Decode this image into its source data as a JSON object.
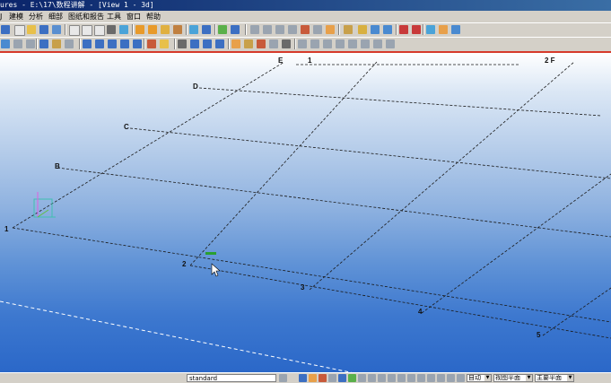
{
  "window": {
    "title": "ures - E:\\17\\数程讲解 - [View 1 - 3d]"
  },
  "menu": {
    "items": [
      {
        "label": "J"
      },
      {
        "label": "建模"
      },
      {
        "label": "分析"
      },
      {
        "label": "细部"
      },
      {
        "label": "图纸和报告"
      },
      {
        "label": "工具"
      },
      {
        "label": "窗口"
      },
      {
        "label": "帮助"
      }
    ]
  },
  "viewport": {
    "grid_labels_top": [
      "E",
      "1",
      "2 F"
    ],
    "grid_labels_left": [
      "D",
      "C",
      "B"
    ],
    "grid_labels_bottom": [
      "1",
      "2",
      "3",
      "4",
      "5"
    ]
  },
  "statusbar": {
    "view_filter_value": "standard",
    "combo1_value": "自动",
    "combo2_value": "视图平面",
    "combo3_value": "主要平面"
  },
  "colors": {
    "accent_red": "#d63a2a",
    "grid_line": "#1a1a1a",
    "ground_line": "#ffffff"
  }
}
